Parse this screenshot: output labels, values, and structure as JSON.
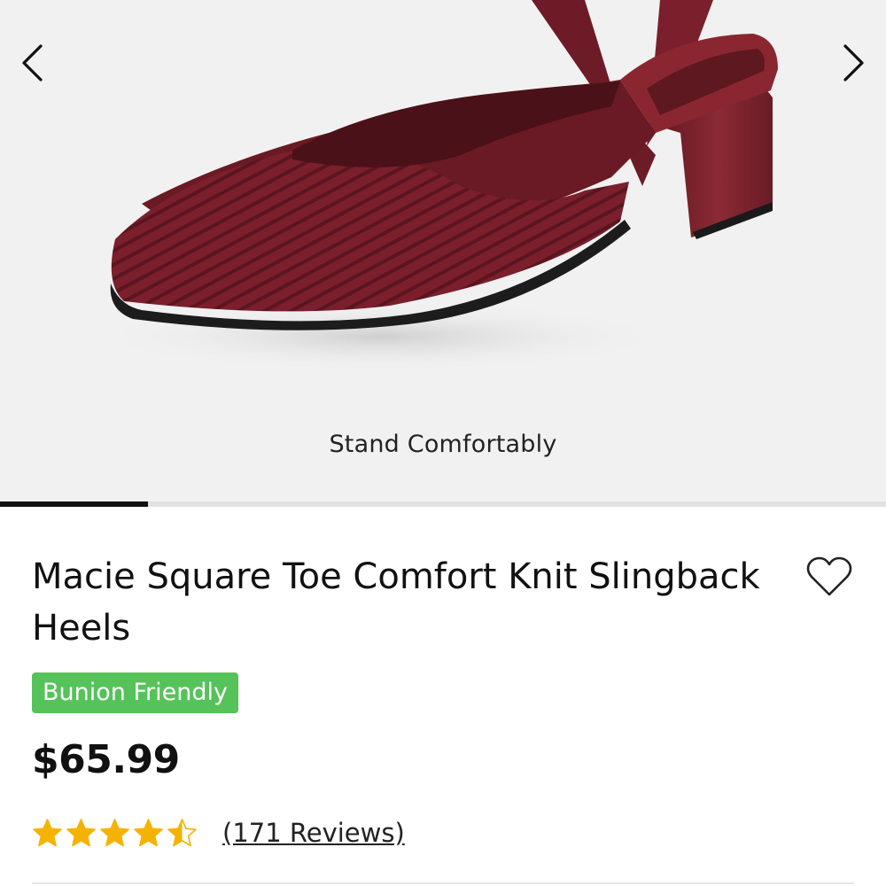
{
  "gallery": {
    "caption": "Stand Comfortably",
    "progress_fraction": 0.167,
    "shoe_color": "#7a1f2b",
    "prev_icon": "chevron-left-icon",
    "next_icon": "chevron-right-icon"
  },
  "product": {
    "title": "Macie Square Toe Comfort Knit Slingback Heels",
    "badge": "Bunion Friendly",
    "badge_color": "#55c35a",
    "price": "$65.99",
    "rating": 4.5,
    "rating_max": 5,
    "star_color": "#f5b301",
    "reviews_label": "(171 Reviews)",
    "wishlist_icon": "heart-outline-icon"
  }
}
